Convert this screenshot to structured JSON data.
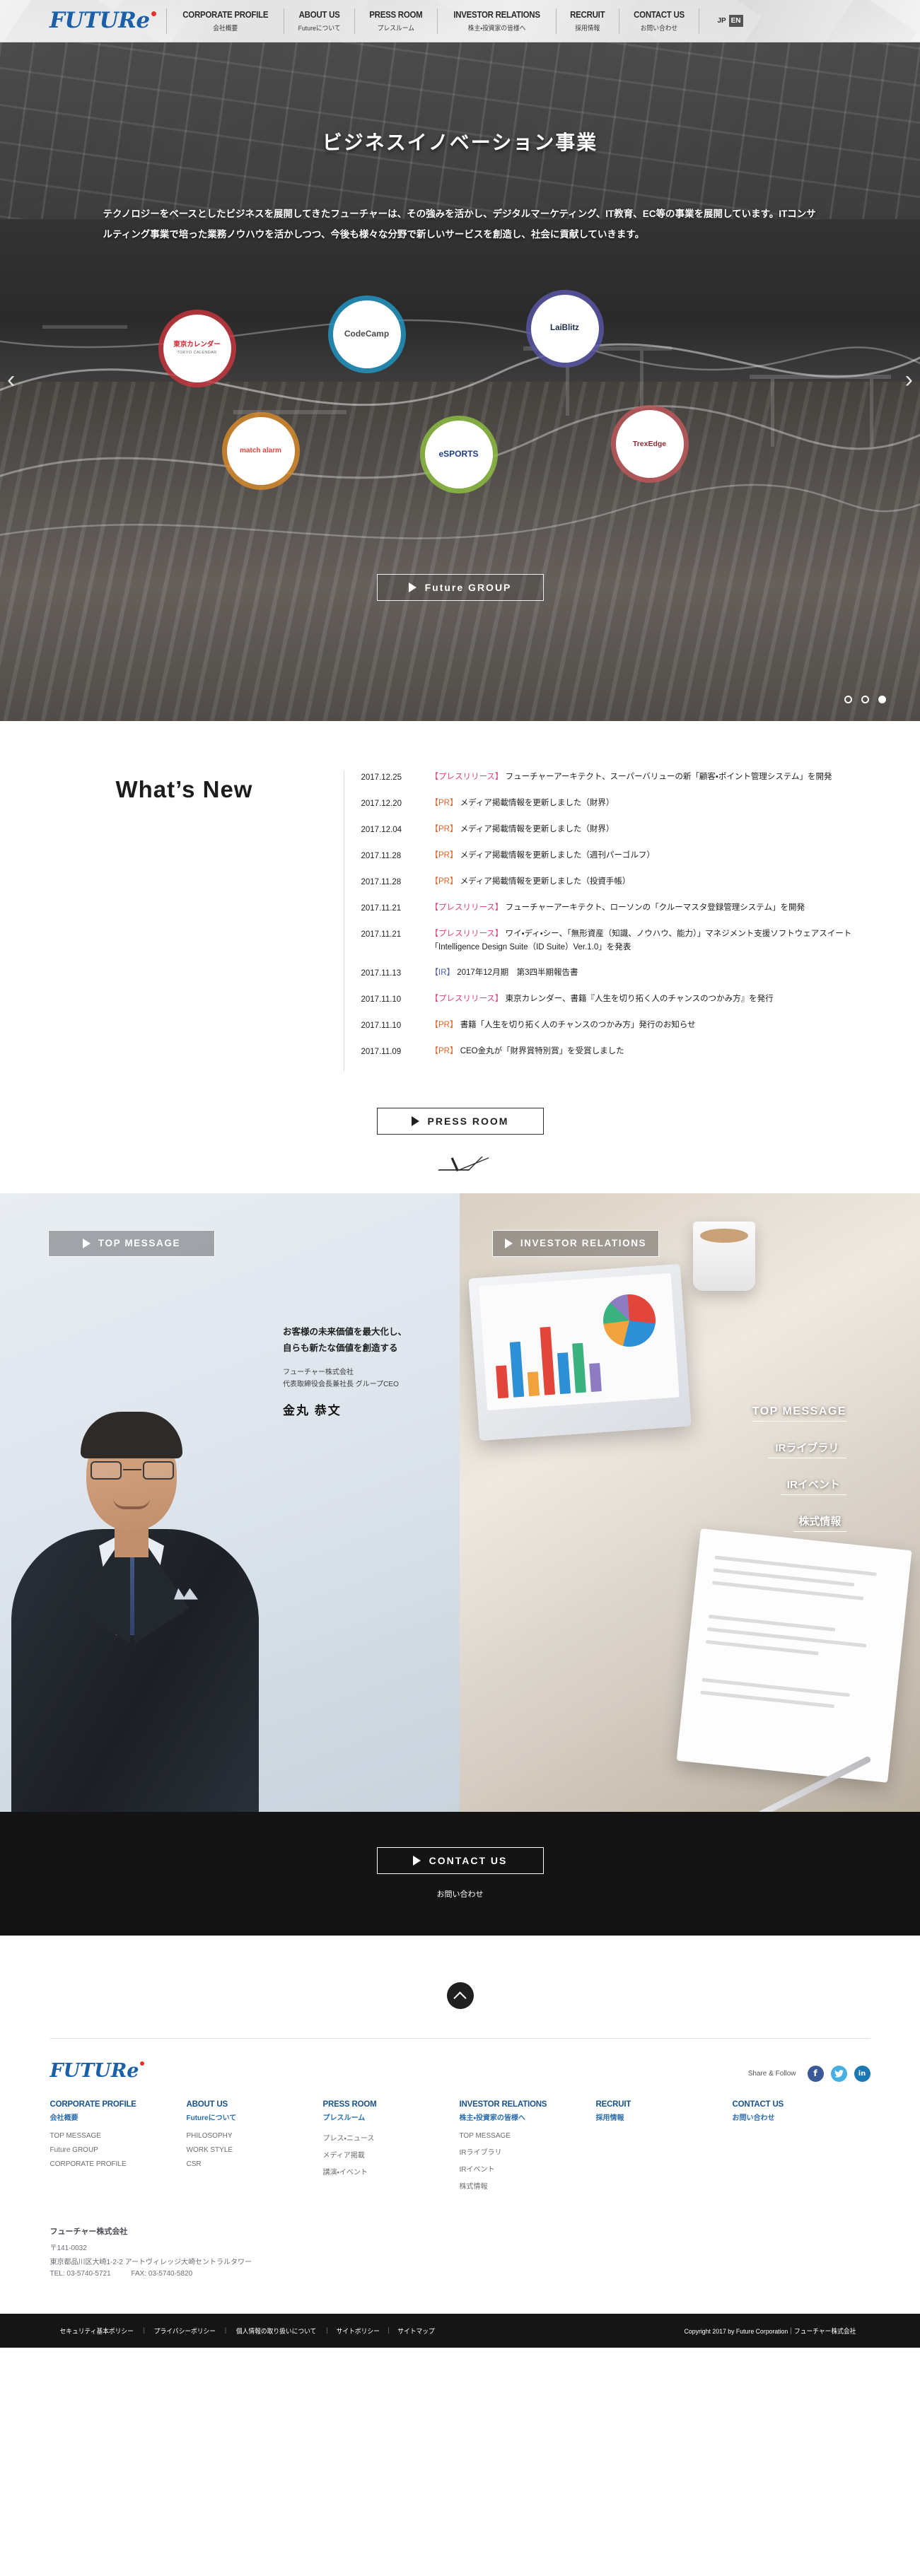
{
  "header": {
    "logo_text": "FUTURe",
    "nav": [
      {
        "en": "CORPORATE PROFILE",
        "jp": "会社概要"
      },
      {
        "en": "ABOUT US",
        "jp": "Futureについて"
      },
      {
        "en": "PRESS ROOM",
        "jp": "プレスルーム"
      },
      {
        "en": "INVESTOR RELATIONS",
        "jp": "株主・投資家の皆様へ"
      },
      {
        "en": "RECRUIT",
        "jp": "採用情報"
      },
      {
        "en": "CONTACT US",
        "jp": "お問い合わせ"
      }
    ],
    "lang": {
      "jp": "JP",
      "en": "EN"
    }
  },
  "hero": {
    "title": "ビジネスイノベーション事業",
    "lead": "テクノロジーをベースとしたビジネスを展開してきたフューチャーは、その強みを活かし、デジタルマーケティング、IT教育、EC等の事業を展開しています。ITコンサルティング事業で培った業務ノウハウを活かしつつ、今後も様々な分野で新しいサービスを創造し、社会に貢献していきます。",
    "brands": [
      {
        "name": "東京カレンダー",
        "sub": "TOKYO CALENDAR",
        "color": "#c8373f",
        "text_color": "#d3212d"
      },
      {
        "name": "CodeCamp",
        "sub": "",
        "color": "#2196c4",
        "text_color": "#4a4a4a"
      },
      {
        "name": "LaiBlitz",
        "sub": "",
        "color": "#5a56a8",
        "text_color": "#1b2b4a"
      },
      {
        "name": "match alarm",
        "sub": "",
        "color": "#d98b2b",
        "text_color": "#e8453c"
      },
      {
        "name": "eSPORTS",
        "sub": "",
        "color": "#8dbf3f",
        "text_color": "#1a3d8f"
      },
      {
        "name": "TrexEdge",
        "sub": "",
        "color": "#c0585c",
        "text_color": "#8c2b33"
      }
    ],
    "cta_label": "Future GROUP",
    "dots": 3,
    "active_dot": 3,
    "prev_arrow": "‹",
    "next_arrow": "›"
  },
  "news": {
    "heading": "What’s New",
    "items": [
      {
        "date": "2017.12.25",
        "tag": "【プレスリリース】",
        "tag_type": "press",
        "text": "フューチャーアーキテクト、スーパーバリューの新「顧客・ポイント管理システム」を開発"
      },
      {
        "date": "2017.12.20",
        "tag": "【PR】",
        "tag_type": "pr",
        "text": "メディア掲載情報を更新しました（財界）"
      },
      {
        "date": "2017.12.04",
        "tag": "【PR】",
        "tag_type": "pr",
        "text": "メディア掲載情報を更新しました（財界）"
      },
      {
        "date": "2017.11.28",
        "tag": "【PR】",
        "tag_type": "pr",
        "text": "メディア掲載情報を更新しました（週刊パーゴルフ）"
      },
      {
        "date": "2017.11.28",
        "tag": "【PR】",
        "tag_type": "pr",
        "text": "メディア掲載情報を更新しました（投資手帳）"
      },
      {
        "date": "2017.11.21",
        "tag": "【プレスリリース】",
        "tag_type": "press",
        "text": "フューチャーアーキテクト、ローソンの「クルーマスタ登録管理システム」を開発"
      },
      {
        "date": "2017.11.21",
        "tag": "【プレスリリース】",
        "tag_type": "press",
        "text": "ワイ・ディ・シー、「無形資産（知識、ノウハウ、能力）」マネジメント支援ソフトウェアスイート「Intelligence Design Suite（ID Suite）Ver.1.0」を発表"
      },
      {
        "date": "2017.11.13",
        "tag": "【IR】",
        "tag_type": "ir",
        "text": "2017年12月期　第3四半期報告書"
      },
      {
        "date": "2017.11.10",
        "tag": "【プレスリリース】",
        "tag_type": "press",
        "text": "東京カレンダー、書籍『人生を切り拓く人のチャンスのつかみ方』を発行"
      },
      {
        "date": "2017.11.10",
        "tag": "【PR】",
        "tag_type": "pr",
        "text": "書籍「人生を切り拓く人のチャンスのつかみ方」発行のお知らせ"
      },
      {
        "date": "2017.11.09",
        "tag": "【PR】",
        "tag_type": "pr",
        "text": "CEO金丸が「財界賞特別賞」を受賞しました"
      }
    ],
    "button_label": "PRESS ROOM"
  },
  "panels": {
    "left": {
      "button_label": "TOP MESSAGE",
      "lead_line1": "お客様の未来価値を最大化し、",
      "lead_line2": "自らも新たな価値を創造する",
      "company": "フューチャー株式会社",
      "role": "代表取締役会長兼社長 グループCEO",
      "name": "金丸 恭文"
    },
    "right": {
      "button_label": "INVESTOR RELATIONS",
      "links": [
        "TOP MESSAGE",
        "IRライブラリ",
        "IRイベント",
        "株式情報"
      ]
    }
  },
  "contact_band": {
    "button_label": "CONTACT US",
    "subtitle": "お問い合わせ"
  },
  "footer": {
    "logo_text": "FUTURe",
    "share_label": "Share & Follow",
    "social": [
      {
        "name": "facebook",
        "glyph": "f"
      },
      {
        "name": "twitter",
        "glyph": "🐦"
      },
      {
        "name": "linkedin",
        "glyph": "in"
      }
    ],
    "sitemap": [
      {
        "en": "CORPORATE PROFILE",
        "jp": "会社概要",
        "links": [
          "TOP MESSAGE",
          "Future GROUP",
          "CORPORATE PROFILE"
        ]
      },
      {
        "en": "ABOUT US",
        "jp": "Futureについて",
        "links": [
          "PHILOSOPHY",
          "WORK STYLE",
          "CSR"
        ]
      },
      {
        "en": "PRESS ROOM",
        "jp": "プレスルーム",
        "links": [
          "プレス・ニュース",
          "メディア掲載",
          "講演・イベント"
        ]
      },
      {
        "en": "INVESTOR RELATIONS",
        "jp": "株主・投資家の皆様へ",
        "links": [
          "TOP MESSAGE",
          "IRライブラリ",
          "IRイベント",
          "株式情報"
        ]
      },
      {
        "en": "RECRUIT",
        "jp": "採用情報",
        "links": []
      },
      {
        "en": "CONTACT US",
        "jp": "お問い合わせ",
        "links": []
      }
    ],
    "company": {
      "name": "フューチャー株式会社",
      "postal": "〒141-0032",
      "address": "東京都品川区大崎1-2-2 アートヴィレッジ大崎セントラルタワー",
      "tel": "TEL: 03-5740-5721",
      "fax": "FAX: 03-5740-5820"
    },
    "legal_links": [
      "セキュリティ基本ポリシー",
      "プライバシーポリシー",
      "個人情報の取り扱いについて",
      "サイトポリシー",
      "サイトマップ"
    ],
    "copyright": "Copyright 2017 by Future Corporation｜フューチャー株式会社"
  }
}
